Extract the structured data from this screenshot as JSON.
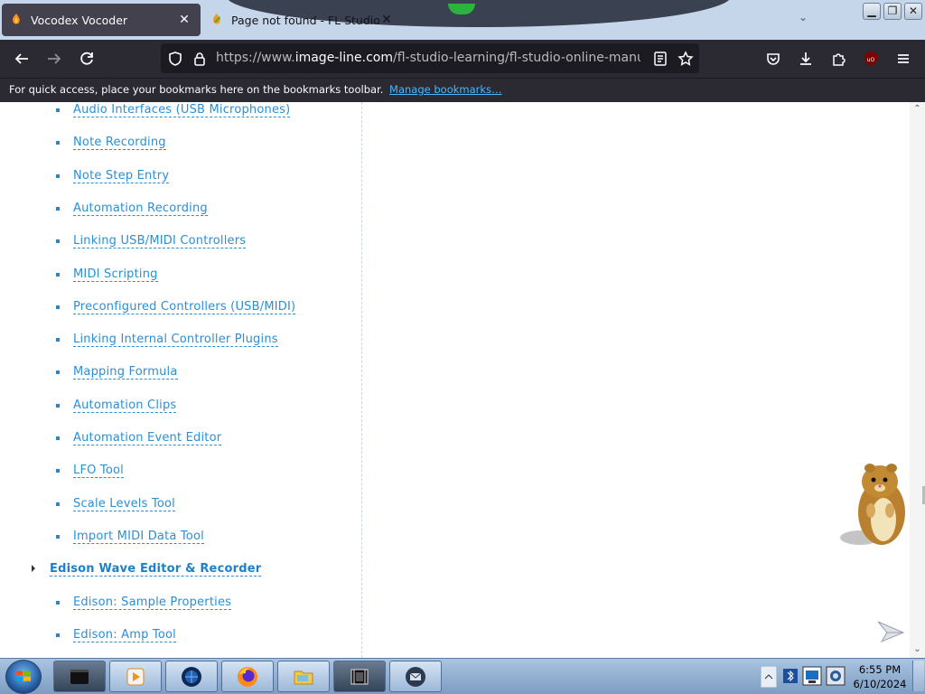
{
  "browser": {
    "tabs": [
      {
        "title": "Vocodex Vocoder",
        "active": true,
        "close_glyph": "✕"
      },
      {
        "title": "Page not found - FL Studio",
        "active": false,
        "close_glyph": "✕"
      }
    ],
    "window_controls": {
      "minimize": "▁",
      "maximize": "❐",
      "close": "✕"
    },
    "url": {
      "prefix": "https://www.",
      "host": "image-line.com",
      "path": "/fl-studio-learning/fl-studio-online-manual/html/g"
    },
    "bookmarks_bar": {
      "message": "For quick access, place your bookmarks here on the bookmarks toolbar.",
      "link": "Manage bookmarks…"
    },
    "colors": {
      "link": "#2a8fd6",
      "toolbar": "#2b2a33",
      "bookmark_link": "#45b8ff"
    }
  },
  "page": {
    "toc": [
      {
        "label": "Audio Interfaces (USB Microphones)",
        "level": 2
      },
      {
        "label": "Note Recording",
        "level": 2
      },
      {
        "label": "Note Step Entry",
        "level": 2
      },
      {
        "label": "Automation Recording",
        "level": 2
      },
      {
        "label": "Linking USB/MIDI Controllers",
        "level": 2
      },
      {
        "label": "MIDI Scripting",
        "level": 2
      },
      {
        "label": "Preconfigured Controllers (USB/MIDI)",
        "level": 2
      },
      {
        "label": "Linking Internal Controller Plugins",
        "level": 2
      },
      {
        "label": "Mapping Formula",
        "level": 2
      },
      {
        "label": "Automation Clips",
        "level": 2
      },
      {
        "label": "Automation Event Editor",
        "level": 2
      },
      {
        "label": "LFO Tool",
        "level": 2
      },
      {
        "label": "Scale Levels Tool",
        "level": 2
      },
      {
        "label": "Import MIDI Data Tool",
        "level": 2
      },
      {
        "label": "Edison Wave Editor & Recorder",
        "level": 1
      },
      {
        "label": "Edison: Sample Properties",
        "level": 2
      },
      {
        "label": "Edison: Amp Tool",
        "level": 2
      }
    ]
  },
  "taskbar": {
    "apps": [
      "terminal-app",
      "media-player-app",
      "browser-globe-app",
      "firefox-app",
      "file-explorer-app",
      "video-editor-app",
      "mail-app"
    ],
    "clock": {
      "time": "6:55 PM",
      "date": "6/10/2024"
    }
  }
}
